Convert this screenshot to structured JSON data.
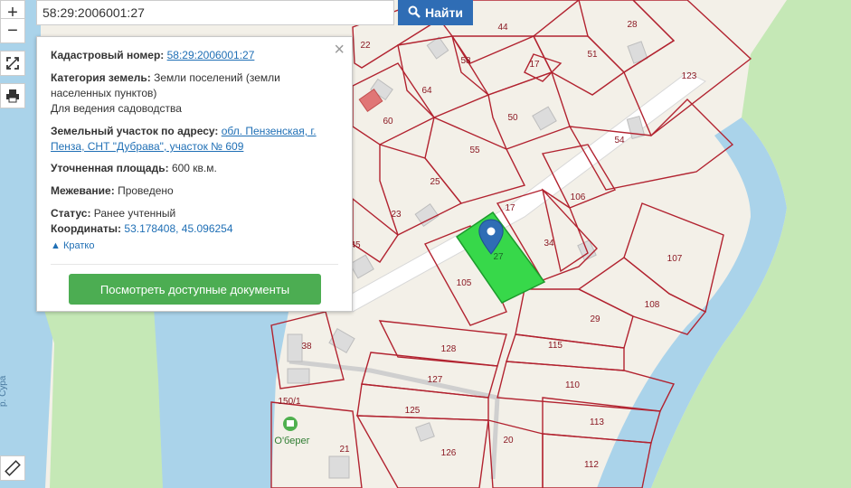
{
  "search": {
    "value": "58:29:2006001:27",
    "button_label": "Найти"
  },
  "controls": {
    "zoom_in": "+",
    "zoom_out": "−"
  },
  "popup": {
    "cadastral_label": "Кадастровый номер:",
    "cadastral_value": "58:29:2006001:27",
    "category_label": "Категория земель:",
    "category_value": "Земли поселений (земли",
    "category_value_2": "населенных пунктов)",
    "usage": "Для ведения садоводства",
    "address_label": "Земельный участок по адресу:",
    "address_line1": "обл. Пензенская, г.",
    "address_line2": "Пенза, СНТ \"Дубрава\", участок № 609",
    "area_label": "Уточненная площадь:",
    "area_value": "600 кв.м.",
    "survey_label": "Межевание:",
    "survey_value": "Проведено",
    "status_label": "Статус:",
    "status_value": "Ранее учтенный",
    "coords_label": "Координаты:",
    "coords_value": "53.178408, 45.096254",
    "collapse_label": "Кратко",
    "docs_button": "Посмотреть доступные документы"
  },
  "map": {
    "selected_parcel": "27",
    "parcels": [
      "22",
      "44",
      "28",
      "58",
      "17",
      "51",
      "123",
      "64",
      "60",
      "50",
      "54",
      "55",
      "25",
      "106",
      "23",
      "17",
      "45",
      "34",
      "105",
      "107",
      "108",
      "29",
      "38",
      "128",
      "115",
      "127",
      "110",
      "150/1",
      "125",
      "113",
      "21",
      "126",
      "20",
      "112"
    ],
    "poi_label": "О'берег",
    "river_label": "р. Сура",
    "colors": {
      "parcel_line": "#b22330",
      "selected_fill": "#37d84a",
      "water": "#aad3ea",
      "greenery": "#c5e8b6",
      "land": "#f3f0e8",
      "search_button": "#2f6db5",
      "docs_button": "#4cad52",
      "link": "#1f6fb5"
    }
  }
}
